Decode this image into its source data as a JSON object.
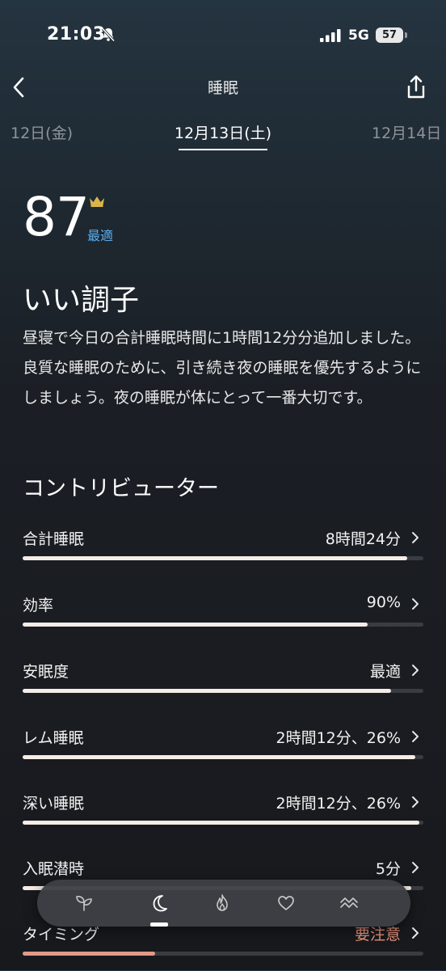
{
  "status_bar": {
    "time": "21:03",
    "network": "5G",
    "battery": "57"
  },
  "header": {
    "title": "睡眠"
  },
  "date_nav": {
    "prev": "12日(金)",
    "current": "12月13日(土)",
    "next": "12月14日"
  },
  "score": {
    "value": "87",
    "label": "最適"
  },
  "headline": "いい調子",
  "summary": "昼寝で今日の合計睡眠時間に1時間12分分追加しました。良質な睡眠のために、引き続き夜の睡眠を優先するようにしましょう。夜の睡眠が体にとって一番大切です。",
  "contributors": {
    "title": "コントリビューター",
    "items": [
      {
        "name": "合計睡眠",
        "value": "8時間24分",
        "level": 0.96,
        "status": "normal"
      },
      {
        "name": "効率",
        "value": "90%",
        "level": 0.86,
        "status": "normal"
      },
      {
        "name": "安眠度",
        "value": "最適",
        "level": 0.92,
        "status": "normal"
      },
      {
        "name": "レム睡眠",
        "value": "2時間12分、26%",
        "level": 0.98,
        "status": "normal"
      },
      {
        "name": "深い睡眠",
        "value": "2時間12分、26%",
        "level": 0.99,
        "status": "normal"
      },
      {
        "name": "入眠潜時",
        "value": "5分",
        "level": 0.97,
        "status": "normal"
      },
      {
        "name": "タイミング",
        "value": "要注意",
        "level": 0.33,
        "status": "warning"
      }
    ]
  },
  "tab_bar": {
    "tabs": [
      "sprout-icon",
      "moon-icon",
      "flame-icon",
      "heart-icon",
      "waves-icon"
    ],
    "active": "moon-icon"
  },
  "colors": {
    "accent_blue": "#5aaef0",
    "warning": "#e8937a",
    "bar_fill": "#f4ece6",
    "bar_track": "#3a3c42",
    "crown": "#d9b44a"
  }
}
